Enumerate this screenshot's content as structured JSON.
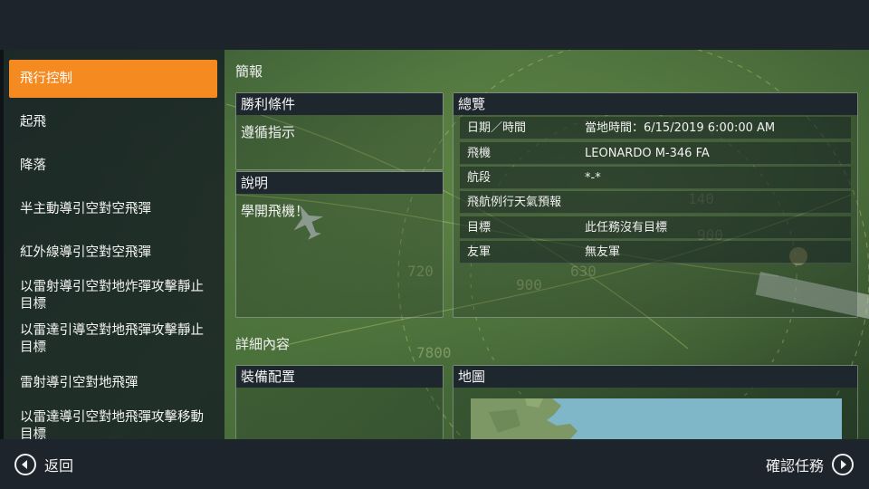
{
  "sidebar": {
    "items": [
      {
        "label": "飛行控制",
        "active": true
      },
      {
        "label": "起飛"
      },
      {
        "label": "降落"
      },
      {
        "label": "半主動導引空對空飛彈"
      },
      {
        "label": "紅外線導引空對空飛彈"
      },
      {
        "label": "以雷射導引空對地炸彈攻擊靜止目標"
      },
      {
        "label": "以雷達引導空對地飛彈攻擊靜止目標"
      },
      {
        "label": "雷射導引空對地飛彈"
      },
      {
        "label": "以雷達導引空對地飛彈攻擊移動目標"
      }
    ]
  },
  "summary": {
    "section_title": "簡報",
    "victory": {
      "header": "勝利條件",
      "text": "遵循指示"
    },
    "description": {
      "header": "說明",
      "text": "學開飛機！"
    },
    "overview": {
      "header": "總覽",
      "rows": [
        {
          "key": "日期／時間",
          "value": "當地時間：6/15/2019 6:00:00 AM"
        },
        {
          "key": "飛機",
          "value": "LEONARDO M-346 FA"
        },
        {
          "key": "航段",
          "value": "*-*"
        },
        {
          "key": "飛航例行天氣預報",
          "value": ""
        },
        {
          "key": "目標",
          "value": "此任務沒有目標"
        },
        {
          "key": "友軍",
          "value": "無友軍"
        }
      ]
    }
  },
  "details": {
    "section_title": "詳細內容",
    "loadout": {
      "header": "裝備配置"
    },
    "map": {
      "header": "地圖"
    }
  },
  "footer": {
    "back_label": "返回",
    "confirm_label": "確認任務"
  },
  "colors": {
    "accent": "#f58a20",
    "bar": "#1e242b"
  }
}
